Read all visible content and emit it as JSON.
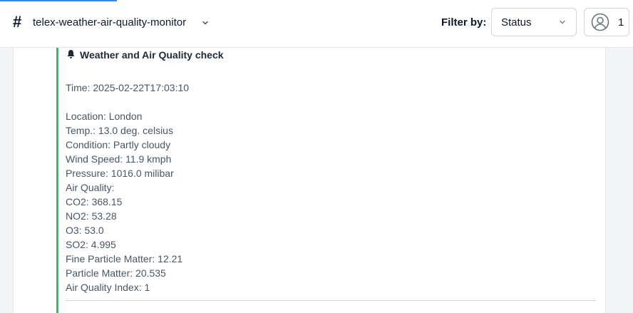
{
  "header": {
    "channel_name": "telex-weather-air-quality-monitor",
    "filter_label": "Filter by:",
    "status_select_value": "Status",
    "member_count": "1",
    "accent_color": "#3b82f6"
  },
  "message": {
    "title": "Weather and Air Quality check",
    "accent_color": "#22c55e",
    "time": "Time: 2025-02-22T17:03:10",
    "lines": [
      "Location: London",
      "Temp.: 13.0 deg. celsius",
      "Condition: Partly cloudy",
      "Wind Speed: 11.9 kmph",
      "Pressure: 1016.0 milibar",
      "Air Quality:",
      "CO2: 368.15",
      "NO2: 53.28",
      "O3: 53.0",
      "SO2: 4.995",
      "Fine Particle Matter: 12.21",
      "Particle Matter: 20.535",
      "Air Quality Index: 1"
    ]
  },
  "icons": {
    "channel": "hash-icon",
    "channel_menu": "chevron-down-icon",
    "select": "chevron-down-icon",
    "members": "user-circle-icon",
    "message": "bell-icon"
  }
}
